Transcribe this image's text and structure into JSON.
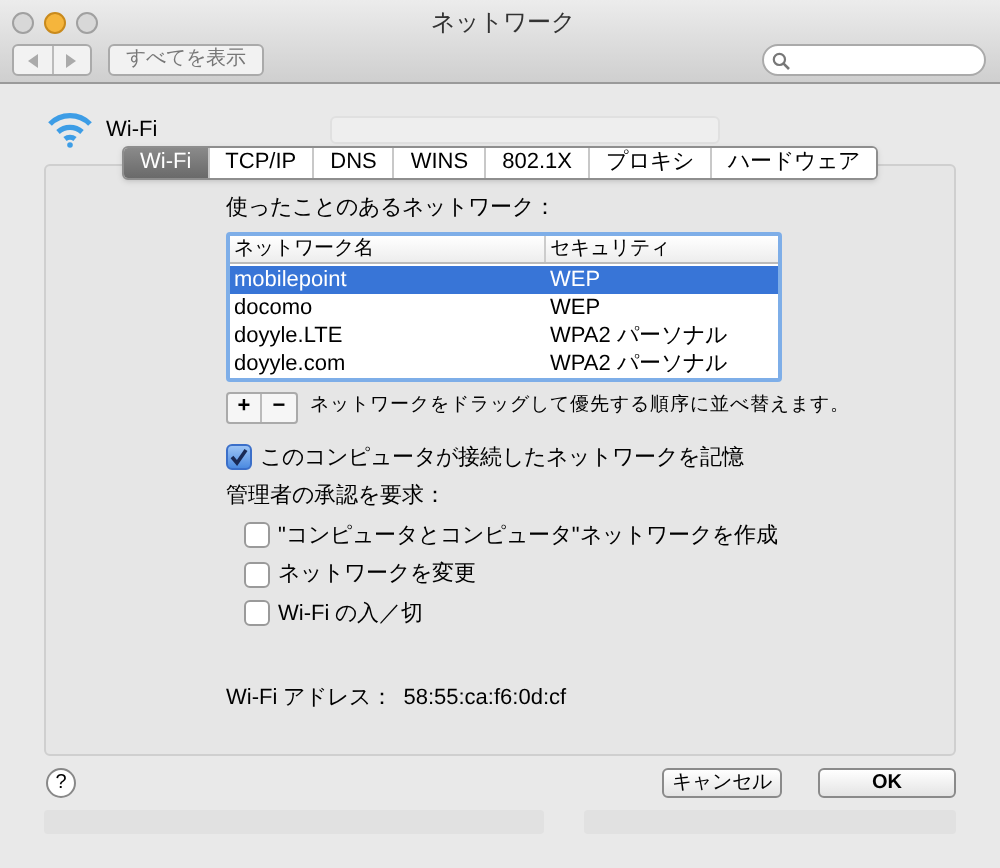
{
  "window": {
    "title": "ネットワーク"
  },
  "toolbar": {
    "show_all": "すべてを表示"
  },
  "service": {
    "name": "Wi-Fi"
  },
  "tabs": [
    {
      "label": "Wi-Fi",
      "selected": true
    },
    {
      "label": "TCP/IP",
      "selected": false
    },
    {
      "label": "DNS",
      "selected": false
    },
    {
      "label": "WINS",
      "selected": false
    },
    {
      "label": "802.1X",
      "selected": false
    },
    {
      "label": "プロキシ",
      "selected": false
    },
    {
      "label": "ハードウェア",
      "selected": false
    }
  ],
  "preferred_networks": {
    "label": "使ったことのあるネットワーク：",
    "columns": [
      "ネットワーク名",
      "セキュリティ"
    ],
    "rows": [
      {
        "name": "mobilepoint",
        "security": "WEP",
        "selected": true
      },
      {
        "name": "docomo",
        "security": "WEP",
        "selected": false
      },
      {
        "name": "doyyle.LTE",
        "security": "WPA2 パーソナル",
        "selected": false
      },
      {
        "name": "doyyle.com",
        "security": "WPA2 パーソナル",
        "selected": false
      }
    ],
    "add": "+",
    "remove": "−",
    "hint": "ネットワークをドラッグして優先する順序に並べ替えます。"
  },
  "remember": {
    "label": "このコンピュータが接続したネットワークを記憶",
    "checked": true
  },
  "admin": {
    "label": "管理者の承認を要求：",
    "options": [
      {
        "label": "\"コンピュータとコンピュータ\"ネットワークを作成",
        "checked": false
      },
      {
        "label": "ネットワークを変更",
        "checked": false
      },
      {
        "label": "Wi-Fi の入／切",
        "checked": false
      }
    ]
  },
  "address": {
    "label": "Wi-Fi アドレス：",
    "value": "58:55:ca:f6:0d:cf"
  },
  "buttons": {
    "help": "?",
    "cancel": "キャンセル",
    "ok": "OK"
  }
}
